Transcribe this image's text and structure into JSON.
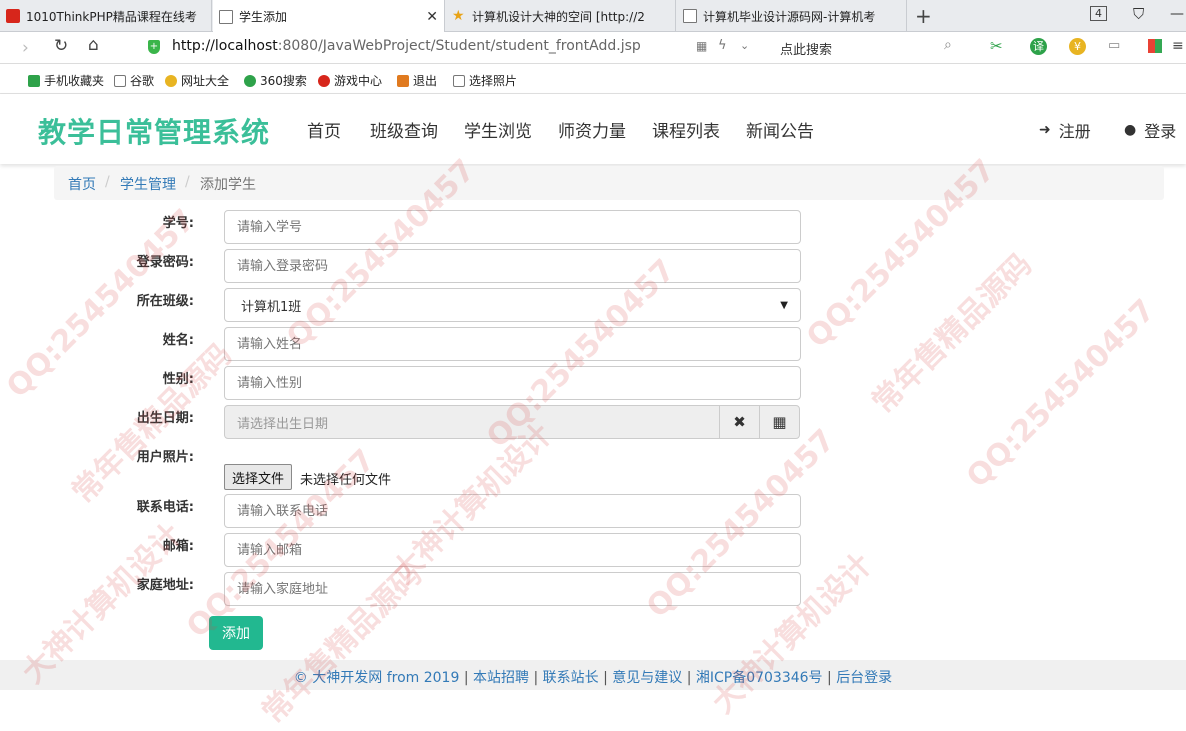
{
  "browser": {
    "tabs": [
      {
        "title": "1010ThinkPHP精品课程在线考",
        "icon": "red-square-icon"
      },
      {
        "title": "学生添加",
        "icon": "page-icon"
      },
      {
        "title": "计算机设计大神的空间 [http://2",
        "icon": "star-icon"
      },
      {
        "title": "计算机毕业设计源码网-计算机考",
        "icon": "page-icon"
      }
    ],
    "tab_count": "4",
    "url_host": "http://localhost",
    "url_rest": ":8080/JavaWebProject/Student/student_frontAdd.jsp",
    "search_hint": "点此搜索",
    "bookmarks": [
      "手机收藏夹",
      "谷歌",
      "网址大全",
      "360搜索",
      "游戏中心",
      "退出",
      "选择照片"
    ]
  },
  "site": {
    "brand": "教学日常管理系统",
    "nav": [
      "首页",
      "班级查询",
      "学生浏览",
      "师资力量",
      "课程列表",
      "新闻公告"
    ],
    "register": "注册",
    "login": "登录"
  },
  "breadcrumb": {
    "home": "首页",
    "section": "学生管理",
    "current": "添加学生"
  },
  "form": {
    "student_no": {
      "label": "学号:",
      "placeholder": "请输入学号"
    },
    "password": {
      "label": "登录密码:",
      "placeholder": "请输入登录密码"
    },
    "class": {
      "label": "所在班级:",
      "value": "计算机1班"
    },
    "name": {
      "label": "姓名:",
      "placeholder": "请输入姓名"
    },
    "gender": {
      "label": "性别:",
      "placeholder": "请输入性别"
    },
    "birthday": {
      "label": "出生日期:",
      "placeholder": "请选择出生日期"
    },
    "photo": {
      "label": "用户照片:",
      "button": "选择文件",
      "status": "未选择任何文件"
    },
    "phone": {
      "label": "联系电话:",
      "placeholder": "请输入联系电话"
    },
    "email": {
      "label": "邮箱:",
      "placeholder": "请输入邮箱"
    },
    "address": {
      "label": "家庭地址:",
      "placeholder": "请输入家庭地址"
    },
    "submit": "添加"
  },
  "footer": {
    "copyright": "© 大神开发网 from 2019",
    "links": [
      "本站招聘",
      "联系站长",
      "意见与建议",
      "湘ICP备0703346号",
      "后台登录"
    ]
  },
  "watermarks": [
    "QQ:254540457",
    "大神计算机设计",
    "常年售精品源码"
  ],
  "colors": {
    "brand": "#3bbf99",
    "link": "#337ab7",
    "submit": "#22b890"
  }
}
